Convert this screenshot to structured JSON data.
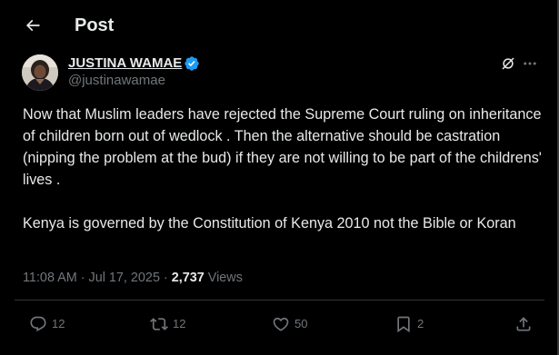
{
  "header": {
    "title": "Post",
    "back_icon": "arrow-left-icon"
  },
  "author": {
    "name": "JUSTINA WAMAE",
    "handle": "@justinawamae",
    "verified": true,
    "verified_color": "#1d9bf0"
  },
  "tweet": {
    "paragraphs": [
      "Now that Muslim leaders have rejected the Supreme Court ruling on inheritance of children born out of wedlock . Then the alternative should be castration (nipping the problem at the bud) if they are not willing to be part of the childrens' lives .",
      "Kenya is governed by the Constitution of Kenya 2010 not the Bible or Koran"
    ]
  },
  "meta": {
    "time": "11:08 AM",
    "separator": "·",
    "date": "Jul 17, 2025",
    "views_count": "2,737",
    "views_label": "Views"
  },
  "actions": {
    "replies": "12",
    "reposts": "12",
    "likes": "50",
    "bookmarks": "2"
  },
  "colors": {
    "background": "#000000",
    "text": "#e7e9ea",
    "muted": "#71767b",
    "border": "#2f3336",
    "accent": "#1d9bf0"
  }
}
